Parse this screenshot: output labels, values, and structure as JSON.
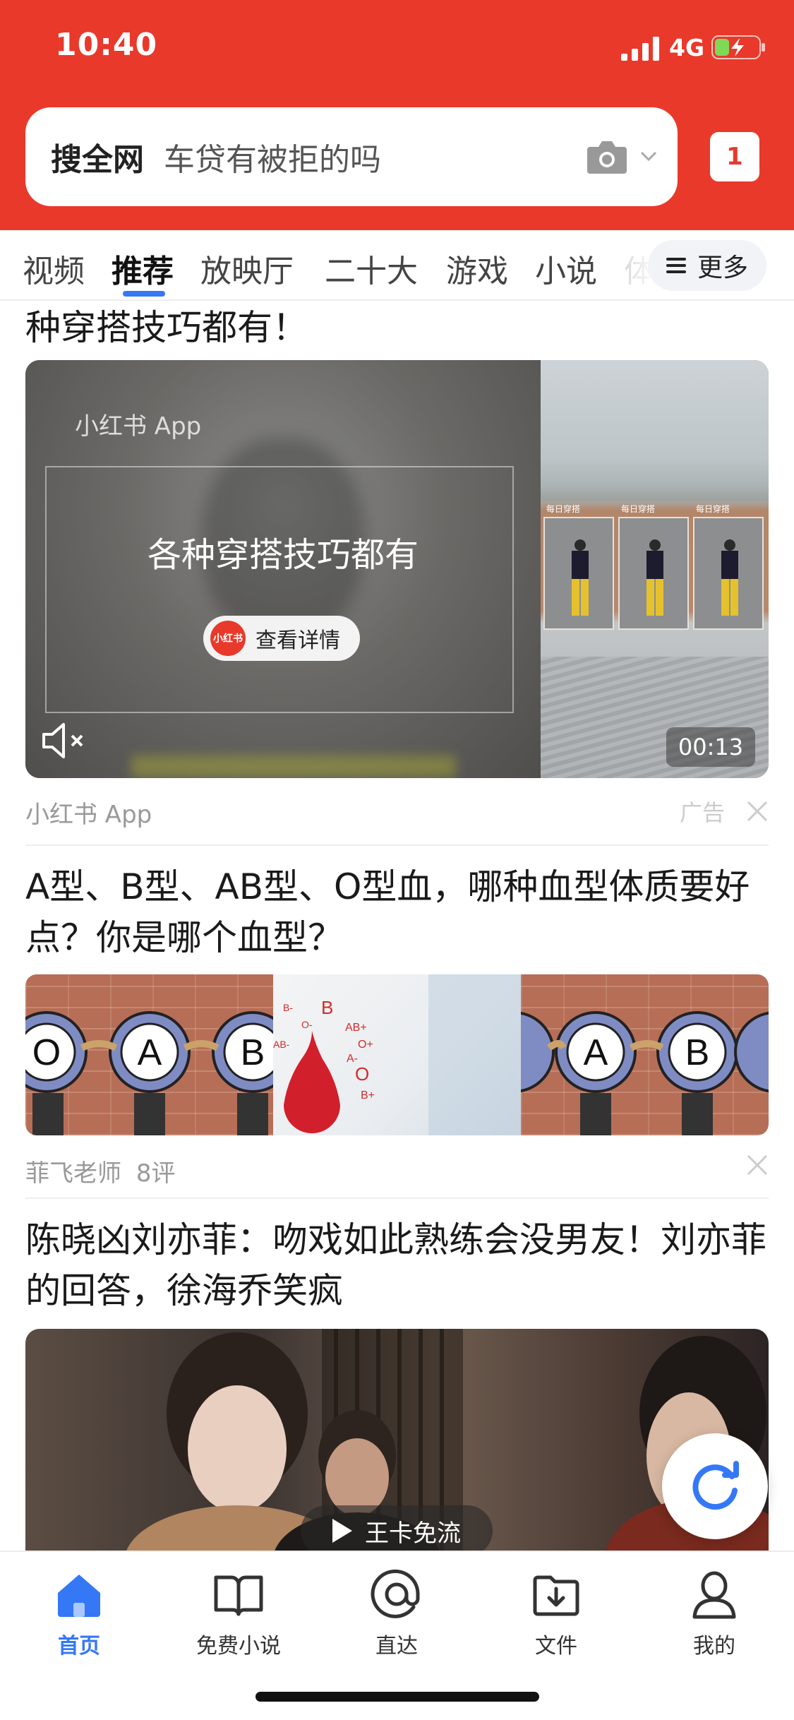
{
  "status_bar": {
    "time": "10:40",
    "network": "4G"
  },
  "search": {
    "scope": "搜全网",
    "query": "车贷有被拒的吗",
    "tab_count": "1"
  },
  "channels": {
    "items": [
      "视频",
      "推荐",
      "放映厅",
      "二十大",
      "游戏",
      "小说",
      "体"
    ],
    "active": "推荐",
    "more_label": "更多"
  },
  "feed": {
    "ad": {
      "title_fragment": "种穿搭技巧都有！",
      "source_overlay": "小红书 App",
      "headline": "各种穿搭技巧都有",
      "brand_badge": "小红书",
      "detail_button": "查看详情",
      "panel_label": "每日穿搭",
      "duration": "00:13",
      "source": "小红书 App",
      "ad_label": "广告"
    },
    "article1": {
      "title": "A型、B型、AB型、O型血，哪种血型体质要好点？你是哪个血型？",
      "image_letters": [
        "O",
        "A",
        "B"
      ],
      "blood_types": [
        "B",
        "AB+",
        "O+",
        "A-",
        "O",
        "B+",
        "B-",
        "O-",
        "AB-"
      ],
      "author": "菲飞老师",
      "comments": "8评"
    },
    "article2": {
      "title": "陈晓凶刘亦菲：吻戏如此熟练会没男友！刘亦菲的回答，徐海乔笑疯",
      "play_label": "王卡免流"
    }
  },
  "tabbar": {
    "items": [
      {
        "label": "首页",
        "icon": "home-icon",
        "active": true
      },
      {
        "label": "免费小说",
        "icon": "book-icon",
        "active": false
      },
      {
        "label": "直达",
        "icon": "at-icon",
        "active": false
      },
      {
        "label": "文件",
        "icon": "download-folder-icon",
        "active": false
      },
      {
        "label": "我的",
        "icon": "person-icon",
        "active": false
      }
    ]
  },
  "colors": {
    "brand_red": "#e8392b",
    "accent_blue": "#3478f6"
  }
}
